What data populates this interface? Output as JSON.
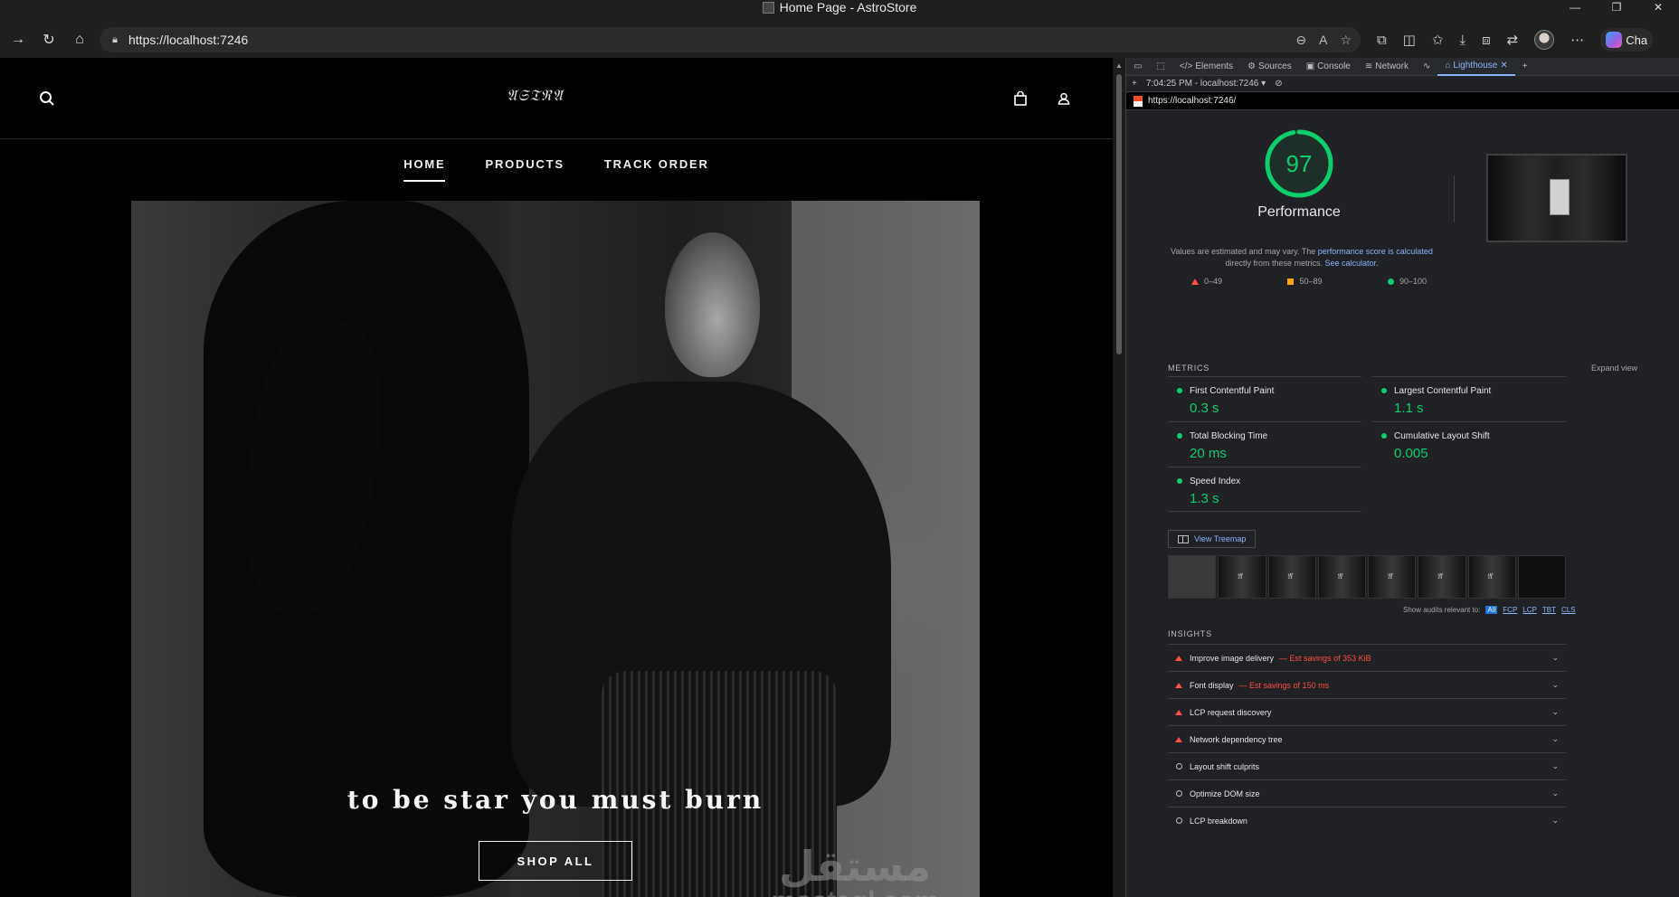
{
  "window": {
    "title": "Home Page - AstroStore"
  },
  "browser": {
    "url": "https://localhost:7246",
    "copilot_label": "Cha"
  },
  "site": {
    "logo": "𝔄𝔖𝔗ℜ𝔄",
    "nav": [
      {
        "label": "HOME",
        "active": true
      },
      {
        "label": "PRODUCTS",
        "active": false
      },
      {
        "label": "TRACK ORDER",
        "active": false
      }
    ],
    "hero_text": "to be star you must burn",
    "cta": "SHOP ALL",
    "watermark_ar": "مستقل",
    "watermark_en": "mostaql.com"
  },
  "devtools": {
    "tabs": [
      "Elements",
      "Sources",
      "Console",
      "Network",
      "Lighthouse"
    ],
    "report_time": "7:04:25 PM - localhost:7246",
    "report_url": "https://localhost:7246/",
    "lighthouse": {
      "score": "97",
      "score_fraction": 0.97,
      "category": "Performance",
      "desc_pre": "Values are estimated and may vary. The ",
      "desc_link1": "performance score is calculated",
      "desc_mid": " directly from these metrics. ",
      "desc_link2": "See calculator.",
      "legend": {
        "fail": "0–49",
        "average": "50–89",
        "pass": "90–100"
      },
      "metrics_title": "METRICS",
      "expand_view": "Expand view",
      "metrics": [
        {
          "name": "First Contentful Paint",
          "value": "0.3 s"
        },
        {
          "name": "Largest Contentful Paint",
          "value": "1.1 s"
        },
        {
          "name": "Total Blocking Time",
          "value": "20 ms"
        },
        {
          "name": "Cumulative Layout Shift",
          "value": "0.005"
        },
        {
          "name": "Speed Index",
          "value": "1.3 s"
        }
      ],
      "treemap": "View Treemap",
      "show_audits_label": "Show audits relevant to:",
      "audit_filters": [
        "All",
        "FCP",
        "LCP",
        "TBT",
        "CLS"
      ],
      "insights_title": "INSIGHTS",
      "insights": [
        {
          "label": "Improve image delivery",
          "savings": "— Est savings of 353 KiB",
          "status": "fail"
        },
        {
          "label": "Font display",
          "savings": "— Est savings of 150 ms",
          "status": "fail"
        },
        {
          "label": "LCP request discovery",
          "savings": "",
          "status": "fail"
        },
        {
          "label": "Network dependency tree",
          "savings": "",
          "status": "fail"
        },
        {
          "label": "Layout shift culprits",
          "savings": "",
          "status": "info"
        },
        {
          "label": "Optimize DOM size",
          "savings": "",
          "status": "info"
        },
        {
          "label": "LCP breakdown",
          "savings": "",
          "status": "info"
        }
      ]
    }
  }
}
